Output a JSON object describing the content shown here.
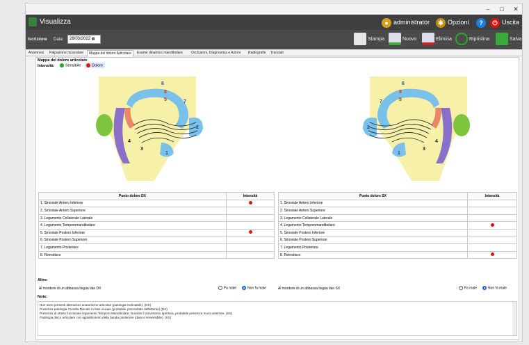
{
  "window": {
    "minimize": "–",
    "maximize": "□",
    "close": "✕"
  },
  "titlebar": {
    "title": "Visualizza",
    "user": "administrator",
    "options": "Opzioni",
    "help": "?",
    "exit": "Uscita"
  },
  "toolbar": {
    "date_label_left": "Iscrizione",
    "date_label": "Data:",
    "date_value": "28/03/2022",
    "print": "Stampa",
    "new": "Nuovo",
    "delete": "Elimina",
    "restore": "Ripristina",
    "save": "Salva"
  },
  "tabs": [
    "Anamnesi",
    "Palpazione muscolare",
    "Mappa del dolore Articolare",
    "Esame dinamico mandibolare",
    "Occlusioni, Diagnostica e Azioni",
    "Radiografie",
    "Tracciati"
  ],
  "active_tab": 2,
  "map": {
    "title": "Mappa del dolore articolare",
    "intensity_label": "Intensità:",
    "legend_sensitive": "Sensibile",
    "legend_pain": "Dolore",
    "colors": {
      "sensitive": "#22aa22",
      "pain": "#e01010"
    },
    "left_numbers": [
      "6",
      "8",
      "5",
      "7",
      "1",
      "2",
      "3",
      "4"
    ],
    "right_numbers": [
      "6",
      "8",
      "5",
      "7",
      "1",
      "2",
      "3",
      "4"
    ]
  },
  "table_dx": {
    "header_point": "Punto dolore DX",
    "header_intensity": "Intensità",
    "rows": [
      {
        "label": "1. Sinoviale Antero Inferiore",
        "pain": true
      },
      {
        "label": "2. Sinoviale Antero Superiore",
        "pain": false
      },
      {
        "label": "3. Legamento Collaterale Laterale",
        "pain": false
      },
      {
        "label": "4. Legamento Temporomandibolare",
        "pain": false
      },
      {
        "label": "5. Sinoviale Postero Inferiore",
        "pain": true
      },
      {
        "label": "6. Sinoviale Postero Superiore",
        "pain": false
      },
      {
        "label": "7. Legamento Posteriore",
        "pain": false
      },
      {
        "label": "8. Retrodisco",
        "pain": false
      }
    ]
  },
  "table_sx": {
    "header_point": "Punto dolore SX",
    "header_intensity": "Intensità",
    "rows": [
      {
        "label": "1. Sinoviale Antero Inferiore",
        "pain": false
      },
      {
        "label": "2. Sinoviale Antero Superiore",
        "pain": false
      },
      {
        "label": "3. Legamento Collaterale Laterale",
        "pain": false
      },
      {
        "label": "4. Legamento Temporomandibolare",
        "pain": true
      },
      {
        "label": "5. Sinoviale Postero Inferiore",
        "pain": false
      },
      {
        "label": "6. Sinoviale Postero Superiore",
        "pain": false
      },
      {
        "label": "7. Legamento Posteriore",
        "pain": false
      },
      {
        "label": "8. Retrodisco",
        "pain": true
      }
    ]
  },
  "altro": {
    "title": "Altro:",
    "q_dx": "Al mordere di un abbassa lingua lato DX",
    "q_sx": "Al mordere di un abbassa lingua lato SX",
    "opt_yes": "Fa male",
    "opt_no": "Non fa male",
    "dx_selected": "no",
    "sx_selected": "no"
  },
  "note": {
    "title": "Note:",
    "lines": [
      "Non sono presenti alterazioni anatomiche articolari (patologia reclinabile). (DX)",
      "Presenza patologia Condilo-Discale in fase iniziale (probabile precontatto deflettente) (DX)",
      "Presenza di stress funzionale legamento Temporo Mandibolare. Durante il movimento apertura, probabile presenza muro anteriore. (SX)",
      "Patologia disco articolare con appiattimento della banda posteriore (danno irreversibile). (SX)"
    ]
  }
}
